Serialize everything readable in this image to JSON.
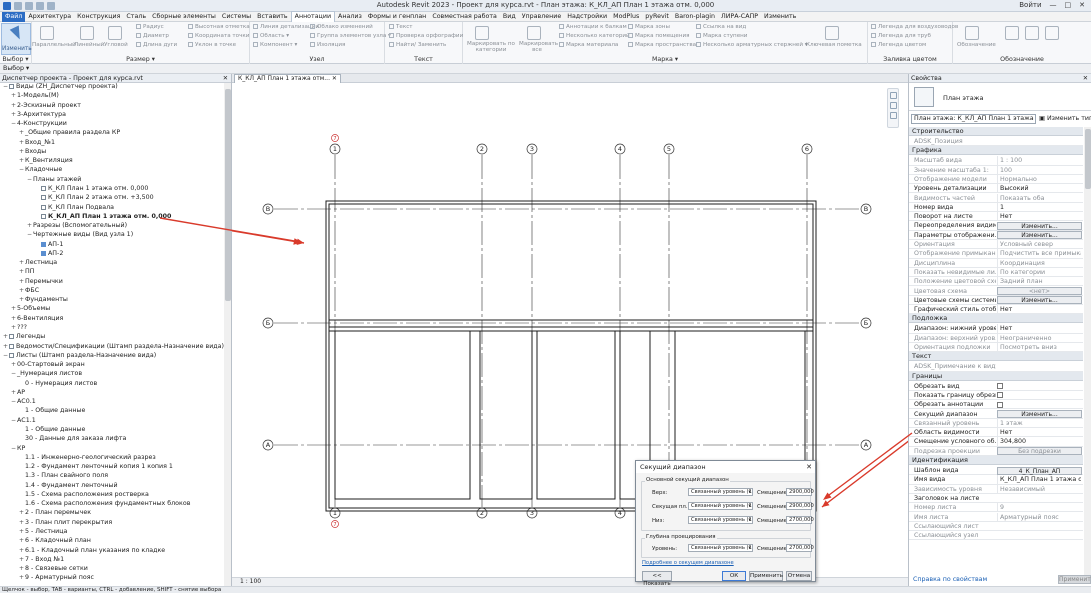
{
  "window": {
    "title": "Autodesk Revit 2023 - Проект для курса.rvt - План этажа: К_КЛ_АП План 1 этажа отм. 0,000",
    "user": "Войти",
    "controls": [
      "—",
      "□",
      "✕"
    ]
  },
  "menu_tabs": [
    "Файл",
    "Архитектура",
    "Конструкция",
    "Сталь",
    "Сборные элементы",
    "Системы",
    "Вставить",
    "Аннотации",
    "Анализ",
    "Формы и генплан",
    "Совместная работа",
    "Вид",
    "Управление",
    "Надстройки",
    "ModPlus",
    "pyRevit",
    "Baron-plagin",
    "ЛИРА-САПР",
    "Изменить"
  ],
  "menu_active": "Аннотации",
  "ribbon": {
    "modify_label": "Изменить",
    "groups": [
      "Выбор ▾",
      "Размер ▾",
      "Узел",
      "Текст",
      "Марка ▾",
      "Заливка цветом",
      "Обозначение"
    ],
    "dim_items": [
      "Параллельный",
      "Линейный",
      "Угловой",
      "Радиус",
      "Диаметр",
      "Длина дуги",
      "Высотная отметка",
      "Координата точки",
      "Уклон в точке"
    ],
    "detail_items": [
      "Линия детализации",
      "Область ▾",
      "Компонент ▾",
      "Облако изменений",
      "Группа элементов узла ▾",
      "Изоляция"
    ],
    "text_items": [
      "Текст",
      "Проверка орфографии",
      "Найти/ Заменить"
    ],
    "tag_items": [
      "Маркировать по категории",
      "Маркировать все",
      "Аннотации к балкам",
      "Несколько категорий",
      "Марка материала",
      "Марка зоны",
      "Марка помещения",
      "Марка пространства",
      "Ссылка на вид",
      "Марка ступени",
      "Несколько арматурных стержней ▾",
      "Ключевая пометка"
    ],
    "fill_items": [
      "Легенда для воздуховодов",
      "Легенда для труб",
      "Легенда цветом"
    ],
    "symbol_label": "Обозначение"
  },
  "select_label": "Выбор ▾",
  "browser": {
    "title": "Диспетчер проекта - Проект для курса.rvt",
    "close": "✕",
    "items": [
      {
        "t": "Виды (ZH_Диспетчер проекта)",
        "l": 0,
        "pm": "−",
        "ic": "v"
      },
      {
        "t": "1-Модель(М)",
        "l": 1,
        "pm": "+"
      },
      {
        "t": "2-Эскизный проект",
        "l": 1,
        "pm": "+"
      },
      {
        "t": "3-Архитектура",
        "l": 1,
        "pm": "+"
      },
      {
        "t": "4-Конструкции",
        "l": 1,
        "pm": "−"
      },
      {
        "t": "_Общие правила раздела КР",
        "l": 2,
        "pm": "+"
      },
      {
        "t": "Вход_№1",
        "l": 2,
        "pm": "+"
      },
      {
        "t": "Входы",
        "l": 2,
        "pm": "+"
      },
      {
        "t": "К_Вентиляция",
        "l": 2,
        "pm": "+"
      },
      {
        "t": "Кладочные",
        "l": 2,
        "pm": "−"
      },
      {
        "t": "Планы этажей",
        "l": 3,
        "pm": "−"
      },
      {
        "t": "К_КЛ План 1 этажа отм. 0,000",
        "l": 4,
        "ic": "v"
      },
      {
        "t": "К_КЛ План 2 этажа отм. +3,500",
        "l": 4,
        "ic": "v"
      },
      {
        "t": "К_КЛ План Подвала",
        "l": 4,
        "ic": "v"
      },
      {
        "t": "К_КЛ_АП План 1 этажа отм. 0,000",
        "l": 4,
        "ic": "v",
        "b": true
      },
      {
        "t": "Разрезы (Вспомогательный)",
        "l": 3,
        "pm": "+"
      },
      {
        "t": "Чертежные виды (Вид узла 1)",
        "l": 3,
        "pm": "−"
      },
      {
        "t": "АП-1",
        "l": 4,
        "ic": "s"
      },
      {
        "t": "АП-2",
        "l": 4,
        "ic": "s"
      },
      {
        "t": "Лестница",
        "l": 2,
        "pm": "+"
      },
      {
        "t": "ПП",
        "l": 2,
        "pm": "+"
      },
      {
        "t": "Перемычки",
        "l": 2,
        "pm": "+"
      },
      {
        "t": "ФБС",
        "l": 2,
        "pm": "+"
      },
      {
        "t": "Фундаменты",
        "l": 2,
        "pm": "+"
      },
      {
        "t": "5-Объемы",
        "l": 1,
        "pm": "+"
      },
      {
        "t": "6-Вентиляция",
        "l": 1,
        "pm": "+"
      },
      {
        "t": "???",
        "l": 1,
        "pm": "+"
      },
      {
        "t": "Легенды",
        "l": 0,
        "pm": "+",
        "ic": "v"
      },
      {
        "t": "Ведомости/Спецификации (Штамп раздела-Назначение вида)",
        "l": 0,
        "pm": "+",
        "ic": "v"
      },
      {
        "t": "Листы (Штамп раздела-Назначение вида)",
        "l": 0,
        "pm": "−",
        "ic": "v"
      },
      {
        "t": "00-Стартовый экран",
        "l": 1,
        "pm": "+"
      },
      {
        "t": "_Нумерация листов",
        "l": 1,
        "pm": "−"
      },
      {
        "t": "0 - Нумерация листов",
        "l": 2
      },
      {
        "t": "АР",
        "l": 1,
        "pm": "+"
      },
      {
        "t": "АС0.1",
        "l": 1,
        "pm": "−"
      },
      {
        "t": "1 - Общие данные",
        "l": 2
      },
      {
        "t": "АС1.1",
        "l": 1,
        "pm": "−"
      },
      {
        "t": "1 - Общие данные",
        "l": 2
      },
      {
        "t": "30 - Данные для заказа лифта",
        "l": 2
      },
      {
        "t": "КР",
        "l": 1,
        "pm": "−"
      },
      {
        "t": "1.1 - Инженерно-геологический разрез",
        "l": 2
      },
      {
        "t": "1.2 - Фундамент ленточный копия 1 копия 1",
        "l": 2
      },
      {
        "t": "1.3 - План свайного поля",
        "l": 2
      },
      {
        "t": "1.4 - Фундамент ленточный",
        "l": 2
      },
      {
        "t": "1.5 - Схема расположения ростверка",
        "l": 2
      },
      {
        "t": "1.6 - Схема расположения фундаментных блоков",
        "l": 2
      },
      {
        "t": "2 - План перемычек",
        "l": 2,
        "pm": "+"
      },
      {
        "t": "3 - План плит перекрытия",
        "l": 2,
        "pm": "+"
      },
      {
        "t": "5 - Лестница",
        "l": 2,
        "pm": "+"
      },
      {
        "t": "6 - Кладочный план",
        "l": 2,
        "pm": "+"
      },
      {
        "t": "6.1 - Кладочный план указания по кладке",
        "l": 2,
        "pm": "+"
      },
      {
        "t": "7 - Вход №1",
        "l": 2,
        "pm": "+"
      },
      {
        "t": "8 - Связевые сетки",
        "l": 2,
        "pm": "+"
      },
      {
        "t": "9 - Арматурный пояс",
        "l": 2,
        "pm": "+"
      }
    ]
  },
  "view_tab": "К_КЛ_АП План 1 этажа отм... ✕",
  "view_scale": "1 : 100",
  "grid": {
    "vertical": [
      "1",
      "2",
      "3",
      "4",
      "5",
      "6"
    ],
    "horizontal": [
      "В",
      "Б",
      "А"
    ],
    "marker": "7"
  },
  "statusbar": "Щелчок - выбор, TAB - варианты, CTRL - добавление, SHIFT - снятие выбора",
  "properties": {
    "title": "Свойства",
    "close": "✕",
    "type_name": "План этажа",
    "selector": "План этажа: К_КЛ_АП План 1 этажа отм ▾",
    "edit_type": "Изменить тип",
    "sections": [
      {
        "name": "Строительство",
        "rows": [
          {
            "k": "ADSK_Позиция",
            "v": "",
            "ro": true
          }
        ]
      },
      {
        "name": "Графика",
        "rows": [
          {
            "k": "Масштаб вида",
            "v": "1 : 100",
            "ro": true
          },
          {
            "k": "Значение масштаба   1:",
            "v": "100",
            "ro": true
          },
          {
            "k": "Отображение модели",
            "v": "Нормально",
            "ro": true
          },
          {
            "k": "Уровень детализации",
            "v": "Высокий"
          },
          {
            "k": "Видимость частей",
            "v": "Показать оба",
            "ro": true
          },
          {
            "k": "Номер вида",
            "v": "1"
          },
          {
            "k": "Поворот на листе",
            "v": "Нет"
          },
          {
            "k": "Переопределения видим...",
            "v": "Изменить...",
            "btn": true
          },
          {
            "k": "Параметры отображени...",
            "v": "Изменить...",
            "btn": true
          },
          {
            "k": "Ориентация",
            "v": "Условный север",
            "ro": true
          },
          {
            "k": "Отображение примыкан...",
            "v": "Подчистить все примыка...",
            "ro": true
          },
          {
            "k": "Дисциплина",
            "v": "Координация",
            "ro": true
          },
          {
            "k": "Показать невидимые ли...",
            "v": "По категории",
            "ro": true
          },
          {
            "k": "Положение цветовой схе...",
            "v": "Задний план",
            "ro": true
          },
          {
            "k": "Цветовая схема",
            "v": "<нет>",
            "btn": true,
            "ro": true
          },
          {
            "k": "Цветовые схемы системы",
            "v": "Изменить...",
            "btn": true
          },
          {
            "k": "Графический стиль отоб...",
            "v": "Нет"
          }
        ]
      },
      {
        "name": "Подложка",
        "rows": [
          {
            "k": "Диапазон: нижний урове...",
            "v": "Нет"
          },
          {
            "k": "Диапазон: верхний уров...",
            "v": "Неограниченно",
            "ro": true
          },
          {
            "k": "Ориентация подложки",
            "v": "Посмотреть вниз",
            "ro": true
          }
        ]
      },
      {
        "name": "Текст",
        "rows": [
          {
            "k": "ADSK_Примечание к виду",
            "v": "",
            "ro": true
          }
        ]
      },
      {
        "name": "Границы",
        "rows": [
          {
            "k": "Обрезать вид",
            "v": "",
            "cb": true
          },
          {
            "k": "Показать границу обрезки",
            "v": "",
            "cb": true
          },
          {
            "k": "Обрезать аннотации",
            "v": "",
            "cb": true
          },
          {
            "k": "Секущий диапазон",
            "v": "Изменить...",
            "btn": true
          },
          {
            "k": "Связанный уровень",
            "v": "1 этаж",
            "ro": true
          },
          {
            "k": "Область видимости",
            "v": "Нет"
          },
          {
            "k": "Смещение условного об...",
            "v": "304,800"
          },
          {
            "k": "Подрезка проекции",
            "v": "Без подрезки",
            "btn": true,
            "ro": true
          }
        ]
      },
      {
        "name": "Идентификация",
        "rows": [
          {
            "k": "Шаблон вида",
            "v": "4_К_План_АП",
            "btn": true
          },
          {
            "k": "Имя вида",
            "v": "К_КЛ_АП План 1 этажа от"
          },
          {
            "k": "Зависимость уровня",
            "v": "Независимый",
            "ro": true
          },
          {
            "k": "Заголовок на листе",
            "v": ""
          },
          {
            "k": "Номер листа",
            "v": "9",
            "ro": true
          },
          {
            "k": "Имя листа",
            "v": "Арматурный пояс",
            "ro": true
          },
          {
            "k": "Ссылающийся лист",
            "v": "",
            "ro": true
          },
          {
            "k": "Ссылающийся узел",
            "v": "",
            "ro": true
          }
        ]
      }
    ],
    "help_link": "Справка по свойствам",
    "apply": "Применить"
  },
  "dialog": {
    "title": "Секущий диапазон",
    "close": "✕",
    "primary_group": "Основной секущий диапазон",
    "rows": [
      {
        "label": "Верх:",
        "level": "Связанный уровень (1 эта",
        "offset_label": "Смещение:",
        "offset": "2900,000"
      },
      {
        "label": "Секущая пл.:",
        "level": "Связанный уровень (1 эта",
        "offset_label": "Смещение:",
        "offset": "2900,000"
      },
      {
        "label": "Низ:",
        "level": "Связанный уровень (1 эта",
        "offset_label": "Смещение:",
        "offset": "2700,000"
      }
    ],
    "depth_group": "Глубина проецирования",
    "depth_row": {
      "label": "Уровень:",
      "level": "Связанный уровень (1 эта",
      "offset_label": "Смещение:",
      "offset": "2700,000"
    },
    "more_link": "Подробнее о секущем диапазоне",
    "show_btn": "<< Показать",
    "ok": "ОК",
    "apply": "Применить",
    "cancel": "Отмена"
  },
  "colors": {
    "annotation_arrow": "#d93a2b",
    "accent": "#2b6cc4"
  }
}
